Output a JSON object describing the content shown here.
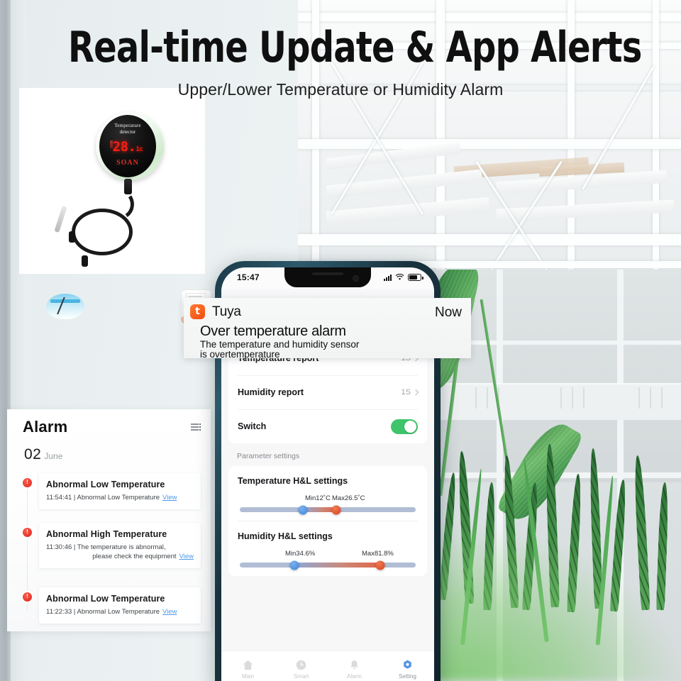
{
  "headline": "Real-time Update & App Alerts",
  "subhead": "Upper/Lower Temperature or Humidity Alarm",
  "product": {
    "display_line1": "Temperature",
    "display_line2": "detector",
    "reading": "28.",
    "reading_unit": "1c",
    "brand": "SOAN"
  },
  "alarm_panel": {
    "title": "Alarm",
    "filter_icon": "list-filter-icon",
    "date_day": "02",
    "date_month": "June",
    "items": [
      {
        "title": "Abnormal Low Temperature",
        "time": "11:54:41",
        "desc": "Abnormal Low Temperature",
        "desc2": "",
        "view": "View"
      },
      {
        "title": "Abnormal High Temperature",
        "time": "11:30:46",
        "desc": "The temperature is abnormal,",
        "desc2": "please check the equipment",
        "view": "View"
      },
      {
        "title": "Abnormal Low Temperature",
        "time": "11:22:33",
        "desc": "Abnormal Low Temperature",
        "desc2": "",
        "view": "View"
      }
    ]
  },
  "phone": {
    "statusbar": {
      "time": "15:47",
      "location_icon": "location-arrow-icon",
      "signal_icon": "cellular-signal-icon",
      "wifi_icon": "wifi-icon",
      "battery_icon": "battery-icon"
    },
    "rows": [
      {
        "label": "Temperature report",
        "value": "1S"
      },
      {
        "label": "Humidity report",
        "value": "1S"
      }
    ],
    "switch_row": {
      "label": "Switch",
      "state": "on"
    },
    "section_title": "Parameter settings",
    "sliders": [
      {
        "title": "Temperature H&L settings",
        "min_label": "Min12˚C",
        "max_label": "Max26.5˚C",
        "min_pct": 36,
        "max_pct": 55
      },
      {
        "title": "Humidity H&L settings",
        "min_label": "Min34.6%",
        "max_label": "Max81.8%",
        "min_pct": 31,
        "max_pct": 80
      }
    ],
    "tabs": [
      {
        "label": "Main",
        "icon": "home-icon",
        "active": false
      },
      {
        "label": "Smart",
        "icon": "clock-icon",
        "active": false
      },
      {
        "label": "Alarm",
        "icon": "bell-icon",
        "active": false
      },
      {
        "label": "Setting",
        "icon": "gear-icon",
        "active": true
      }
    ]
  },
  "notification": {
    "logo_letter": "t",
    "app": "Tuya",
    "time": "Now",
    "title": "Over temperature alarm",
    "body_line1": "The temperature and humidity sensor",
    "body_line2": "is overtemperature"
  },
  "colors": {
    "accent_orange": "#f04e12",
    "toggle_green": "#3ec46a",
    "alert_red": "#d9271a",
    "link_blue": "#4f9ae8",
    "slider_low": "#3f84d8",
    "slider_high": "#d8421f",
    "tab_active": "#4a90e2",
    "led_red": "#f41f14"
  }
}
